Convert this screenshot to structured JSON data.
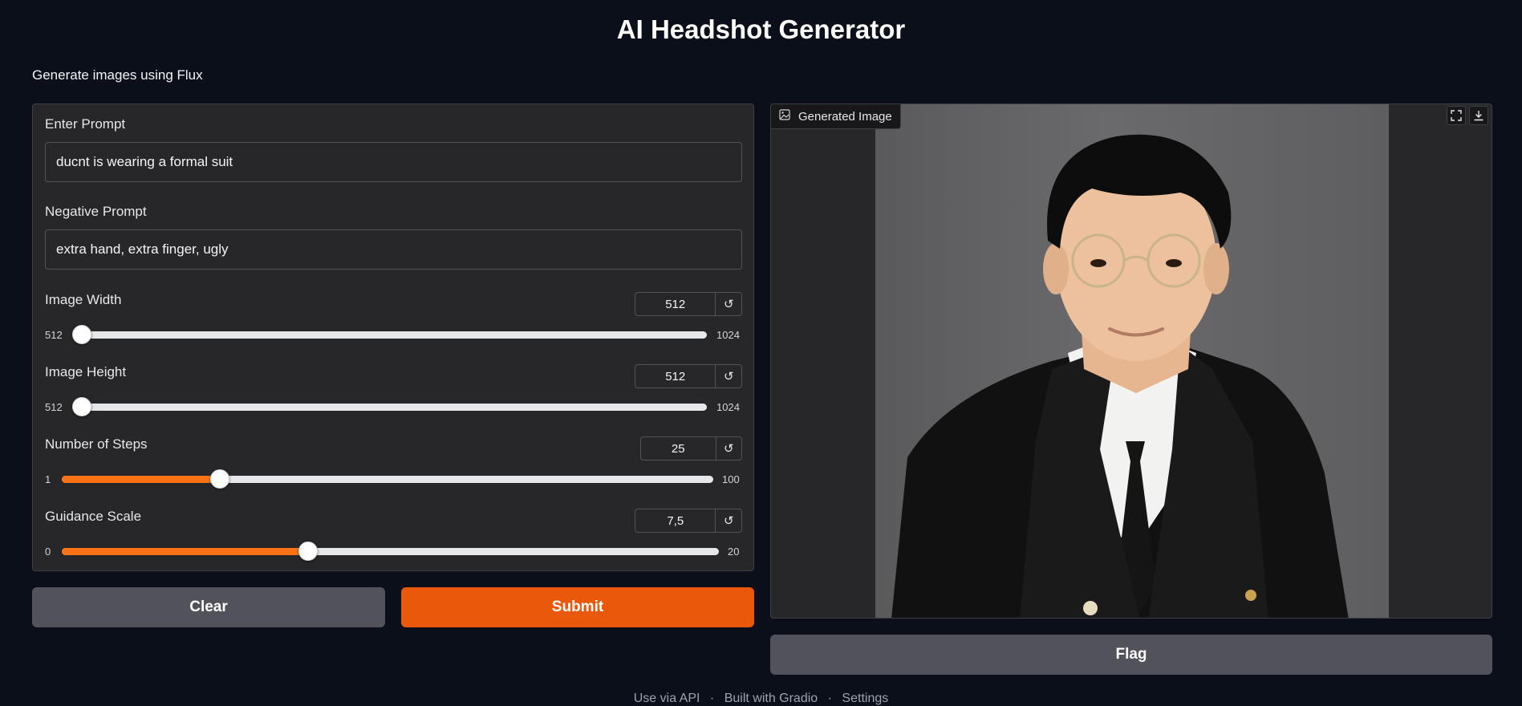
{
  "header": {
    "title": "AI Headshot Generator",
    "subtitle": "Generate images using Flux"
  },
  "form": {
    "prompt": {
      "label": "Enter Prompt",
      "value": "ducnt is wearing a formal suit"
    },
    "negative_prompt": {
      "label": "Negative Prompt",
      "value": "extra hand, extra finger, ugly"
    },
    "width": {
      "label": "Image Width",
      "value": "512",
      "min": "512",
      "max": "1024",
      "fraction": 0
    },
    "height": {
      "label": "Image Height",
      "value": "512",
      "min": "512",
      "max": "1024",
      "fraction": 0
    },
    "steps": {
      "label": "Number of Steps",
      "value": "25",
      "min": "1",
      "max": "100",
      "fraction": 0.2424
    },
    "guidance": {
      "label": "Guidance Scale",
      "value": "7,5",
      "min": "0",
      "max": "20",
      "fraction": 0.375
    },
    "reset_icon": "↺"
  },
  "buttons": {
    "clear": "Clear",
    "submit": "Submit",
    "flag": "Flag"
  },
  "output": {
    "label": "Generated Image",
    "icon": "image-icon",
    "fullscreen_icon": "fullscreen-icon",
    "download_icon": "download-icon"
  },
  "footer": {
    "api": "Use via API",
    "built": "Built with Gradio",
    "settings": "Settings",
    "separator": "·"
  },
  "colors": {
    "accent": "#f97316",
    "submit": "#ea580c",
    "background": "#0b0f19",
    "panel": "#27272a"
  }
}
